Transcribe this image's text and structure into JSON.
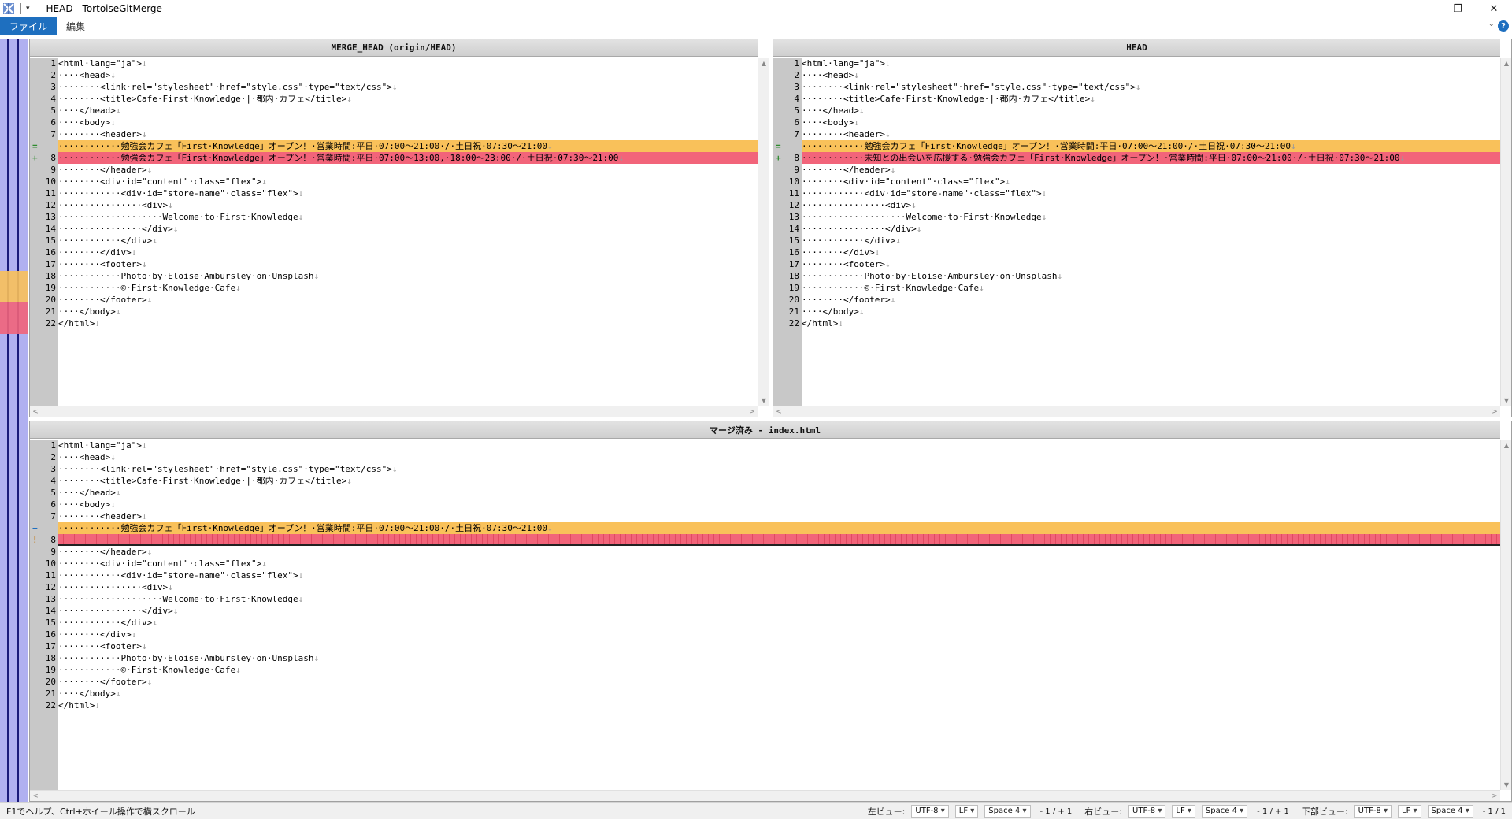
{
  "window": {
    "title": "HEAD - TortoiseGitMerge"
  },
  "ribbon": {
    "tabs": [
      {
        "label": "ファイル",
        "active": true
      },
      {
        "label": "編集",
        "active": false
      }
    ]
  },
  "colors": {
    "moved": "#f9c15a",
    "conflict": "#f2647a",
    "locbar": "#b0b0f0",
    "accent": "#1e6fbf"
  },
  "panes": {
    "left": {
      "title": "MERGE_HEAD (origin/HEAD)",
      "lines": [
        {
          "n": "1",
          "t": "<html·lang=\"ja\">"
        },
        {
          "n": "2",
          "t": "····<head>"
        },
        {
          "n": "3",
          "t": "········<link·rel=\"stylesheet\"·href=\"style.css\"·type=\"text/css\">"
        },
        {
          "n": "4",
          "t": "········<title>Cafe·First·Knowledge·|·都内·カフェ</title>"
        },
        {
          "n": "5",
          "t": "····</head>"
        },
        {
          "n": "6",
          "t": "····<body>"
        },
        {
          "n": "7",
          "t": "········<header>"
        },
        {
          "n": "",
          "t": "············勉強会カフェ「First·Knowledge」オープン！·営業時間:平日·07:00～21:00·/·土日祝·07:30～21:00",
          "mark": "=",
          "hl": "moved"
        },
        {
          "n": "8",
          "t": "············勉強会カフェ「First·Knowledge」オープン！·営業時間:平日·07:00～13:00,·18:00～23:00·/·土日祝·07:30～21:00",
          "mark": "+",
          "hl": "conflict"
        },
        {
          "n": "9",
          "t": "········</header>"
        },
        {
          "n": "10",
          "t": "········<div·id=\"content\"·class=\"flex\">"
        },
        {
          "n": "11",
          "t": "············<div·id=\"store-name\"·class=\"flex\">"
        },
        {
          "n": "12",
          "t": "················<div>"
        },
        {
          "n": "13",
          "t": "····················Welcome·to·First·Knowledge"
        },
        {
          "n": "14",
          "t": "················</div>"
        },
        {
          "n": "15",
          "t": "············</div>"
        },
        {
          "n": "16",
          "t": "········</div>"
        },
        {
          "n": "17",
          "t": "········<footer>"
        },
        {
          "n": "18",
          "t": "············Photo·by·Eloise·Ambursley·on·Unsplash"
        },
        {
          "n": "19",
          "t": "············©·First·Knowledge·Cafe"
        },
        {
          "n": "20",
          "t": "········</footer>"
        },
        {
          "n": "21",
          "t": "····</body>"
        },
        {
          "n": "22",
          "t": "</html>"
        }
      ]
    },
    "right": {
      "title": "HEAD",
      "lines": [
        {
          "n": "1",
          "t": "<html·lang=\"ja\">"
        },
        {
          "n": "2",
          "t": "····<head>"
        },
        {
          "n": "3",
          "t": "········<link·rel=\"stylesheet\"·href=\"style.css\"·type=\"text/css\">"
        },
        {
          "n": "4",
          "t": "········<title>Cafe·First·Knowledge·|·都内·カフェ</title>"
        },
        {
          "n": "5",
          "t": "····</head>"
        },
        {
          "n": "6",
          "t": "····<body>"
        },
        {
          "n": "7",
          "t": "········<header>"
        },
        {
          "n": "",
          "t": "············勉強会カフェ「First·Knowledge」オープン！·営業時間:平日·07:00～21:00·/·土日祝·07:30～21:00",
          "mark": "=",
          "hl": "moved"
        },
        {
          "n": "8",
          "t": "············未知との出会いを応援する·勉強会カフェ「First·Knowledge」オープン！·営業時間:平日·07:00～21:00·/·土日祝·07:30～21:00",
          "mark": "+",
          "hl": "conflict"
        },
        {
          "n": "9",
          "t": "········</header>"
        },
        {
          "n": "10",
          "t": "········<div·id=\"content\"·class=\"flex\">"
        },
        {
          "n": "11",
          "t": "············<div·id=\"store-name\"·class=\"flex\">"
        },
        {
          "n": "12",
          "t": "················<div>"
        },
        {
          "n": "13",
          "t": "····················Welcome·to·First·Knowledge"
        },
        {
          "n": "14",
          "t": "················</div>"
        },
        {
          "n": "15",
          "t": "············</div>"
        },
        {
          "n": "16",
          "t": "········</div>"
        },
        {
          "n": "17",
          "t": "········<footer>"
        },
        {
          "n": "18",
          "t": "············Photo·by·Eloise·Ambursley·on·Unsplash"
        },
        {
          "n": "19",
          "t": "············©·First·Knowledge·Cafe"
        },
        {
          "n": "20",
          "t": "········</footer>"
        },
        {
          "n": "21",
          "t": "····</body>"
        },
        {
          "n": "22",
          "t": "</html>"
        }
      ]
    },
    "bottom": {
      "title": "マージ済み - index.html",
      "lines": [
        {
          "n": "1",
          "t": "<html·lang=\"ja\">"
        },
        {
          "n": "2",
          "t": "····<head>"
        },
        {
          "n": "3",
          "t": "········<link·rel=\"stylesheet\"·href=\"style.css\"·type=\"text/css\">"
        },
        {
          "n": "4",
          "t": "········<title>Cafe·First·Knowledge·|·都内·カフェ</title>"
        },
        {
          "n": "5",
          "t": "····</head>"
        },
        {
          "n": "6",
          "t": "····<body>"
        },
        {
          "n": "7",
          "t": "········<header>"
        },
        {
          "n": "",
          "t": "············勉強会カフェ「First·Knowledge」オープン！·営業時間:平日·07:00～21:00·/·土日祝·07:30～21:00",
          "mark": "−",
          "hl": "moved"
        },
        {
          "n": "8",
          "t": "",
          "mark": "!",
          "hl": "qmark"
        },
        {
          "n": "9",
          "t": "········</header>"
        },
        {
          "n": "10",
          "t": "········<div·id=\"content\"·class=\"flex\">"
        },
        {
          "n": "11",
          "t": "············<div·id=\"store-name\"·class=\"flex\">"
        },
        {
          "n": "12",
          "t": "················<div>"
        },
        {
          "n": "13",
          "t": "····················Welcome·to·First·Knowledge"
        },
        {
          "n": "14",
          "t": "················</div>"
        },
        {
          "n": "15",
          "t": "············</div>"
        },
        {
          "n": "16",
          "t": "········</div>"
        },
        {
          "n": "17",
          "t": "········<footer>"
        },
        {
          "n": "18",
          "t": "············Photo·by·Eloise·Ambursley·on·Unsplash"
        },
        {
          "n": "19",
          "t": "············©·First·Knowledge·Cafe"
        },
        {
          "n": "20",
          "t": "········</footer>"
        },
        {
          "n": "21",
          "t": "····</body>"
        },
        {
          "n": "22",
          "t": "</html>"
        }
      ]
    }
  },
  "statusbar": {
    "help": "F1でヘルプ、Ctrl+ホイール操作で横スクロール",
    "left_view": {
      "label": "左ビュー:",
      "encoding": "UTF-8",
      "eol": "LF",
      "tab": "Space 4",
      "count": "- 1 / + 1"
    },
    "right_view": {
      "label": "右ビュー:",
      "encoding": "UTF-8",
      "eol": "LF",
      "tab": "Space 4",
      "count": "- 1 / + 1"
    },
    "bottom_view": {
      "label": "下部ビュー:",
      "encoding": "UTF-8",
      "eol": "LF",
      "tab": "Space 4",
      "count": "- 1 / 1"
    }
  }
}
